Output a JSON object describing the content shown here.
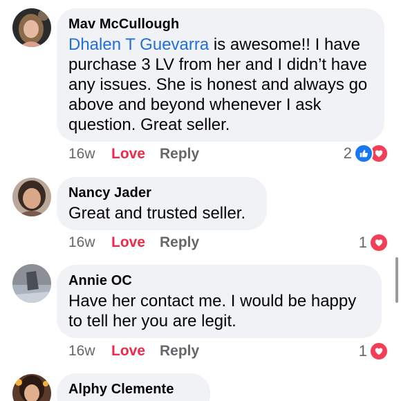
{
  "comments": [
    {
      "author": "Mav McCullough",
      "mention": "Dhalen T Guevarra",
      "text": " is awesome!! I have purchase 3 LV from her and I didn’t have any issues. She is honest and always go above and beyond whenever I ask question. Great seller.",
      "time": "16w",
      "love_label": "Love",
      "reply_label": "Reply",
      "reaction_count": "2",
      "reactions": [
        "like-icon",
        "heart-icon"
      ]
    },
    {
      "author": "Nancy Jader",
      "text": "Great and trusted seller.",
      "time": "16w",
      "love_label": "Love",
      "reply_label": "Reply",
      "reaction_count": "1",
      "reactions": [
        "heart-icon"
      ]
    },
    {
      "author": "Annie OC",
      "text": "Have her contact me. I would be happy to tell her you are legit.",
      "time": "16w",
      "love_label": "Love",
      "reply_label": "Reply",
      "reaction_count": "1",
      "reactions": [
        "heart-icon"
      ]
    },
    {
      "author": "Alphy Clemente"
    }
  ],
  "colors": {
    "bubble": "#f0f2f5",
    "mention": "#216fdb",
    "love": "#f0284a",
    "muted": "#65676b",
    "like": "#1877f2",
    "heart": "#f33e58"
  }
}
